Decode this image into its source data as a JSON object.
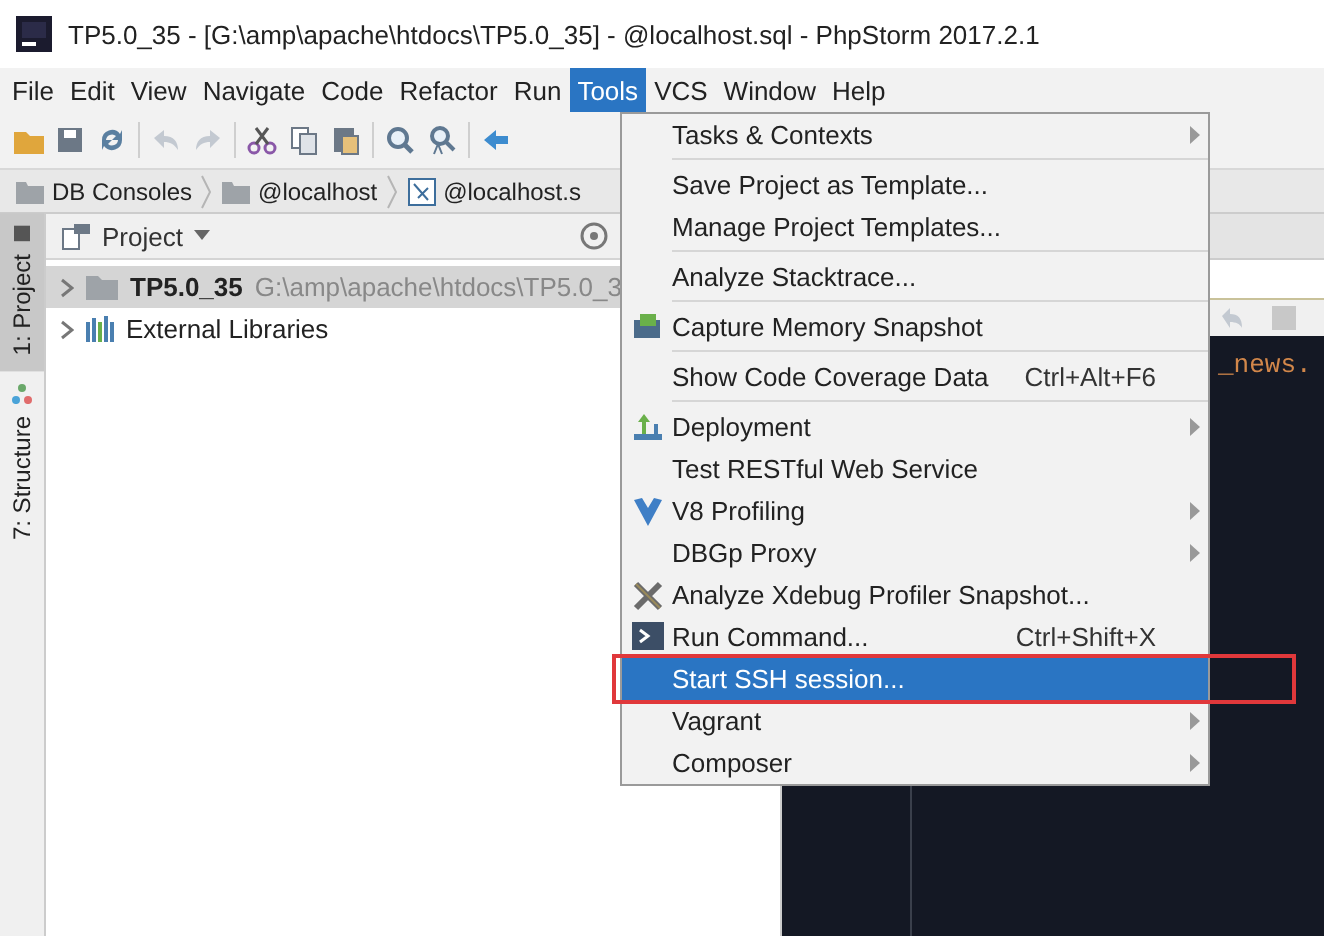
{
  "window": {
    "title": "TP5.0_35 - [G:\\amp\\apache\\htdocs\\TP5.0_35] - @localhost.sql - PhpStorm 2017.2.1"
  },
  "menu_bar": [
    {
      "label": "File",
      "selected": false
    },
    {
      "label": "Edit",
      "selected": false
    },
    {
      "label": "View",
      "selected": false
    },
    {
      "label": "Navigate",
      "selected": false
    },
    {
      "label": "Code",
      "selected": false
    },
    {
      "label": "Refactor",
      "selected": false
    },
    {
      "label": "Run",
      "selected": false
    },
    {
      "label": "Tools",
      "selected": true
    },
    {
      "label": "VCS",
      "selected": false
    },
    {
      "label": "Window",
      "selected": false
    },
    {
      "label": "Help",
      "selected": false
    }
  ],
  "breadcrumbs": [
    {
      "label": "DB Consoles",
      "kind": "folder"
    },
    {
      "label": "@localhost",
      "kind": "folder"
    },
    {
      "label": "@localhost.s",
      "kind": "file"
    }
  ],
  "tool_windows": [
    {
      "label": "1: Project",
      "selected": true
    },
    {
      "label": "7: Structure",
      "selected": false
    }
  ],
  "project_panel": {
    "title": "Project",
    "tree": [
      {
        "label": "TP5.0_35",
        "path": "G:\\amp\\apache\\htdocs\\TP5.0_3",
        "kind": "folder",
        "expanded": false,
        "selected": true
      },
      {
        "label": "External Libraries",
        "kind": "library",
        "expanded": false,
        "selected": false
      }
    ]
  },
  "editor": {
    "code_fragment": "_news."
  },
  "tools_menu": {
    "items": [
      {
        "kind": "item",
        "label": "Tasks & Contexts",
        "submenu": true,
        "selected": false
      },
      {
        "kind": "separator"
      },
      {
        "kind": "item",
        "label": "Save Project as Template...",
        "submenu": false,
        "selected": false
      },
      {
        "kind": "item",
        "label": "Manage Project Templates...",
        "submenu": false,
        "selected": false
      },
      {
        "kind": "separator"
      },
      {
        "kind": "item",
        "label": "Analyze Stacktrace...",
        "submenu": false,
        "selected": false
      },
      {
        "kind": "separator"
      },
      {
        "kind": "item",
        "label": "Capture Memory Snapshot",
        "submenu": false,
        "selected": false
      },
      {
        "kind": "separator"
      },
      {
        "kind": "item",
        "label": "Show Code Coverage Data",
        "shortcut": "Ctrl+Alt+F6",
        "submenu": false,
        "selected": false
      },
      {
        "kind": "separator"
      },
      {
        "kind": "item",
        "label": "Deployment",
        "submenu": true,
        "selected": false
      },
      {
        "kind": "item",
        "label": "Test RESTful Web Service",
        "submenu": false,
        "selected": false
      },
      {
        "kind": "item",
        "label": "V8 Profiling",
        "submenu": true,
        "selected": false
      },
      {
        "kind": "item",
        "label": "DBGp Proxy",
        "submenu": true,
        "selected": false
      },
      {
        "kind": "item",
        "label": "Analyze Xdebug Profiler Snapshot...",
        "submenu": false,
        "selected": false
      },
      {
        "kind": "item",
        "label": "Run Command...",
        "shortcut": "Ctrl+Shift+X",
        "submenu": false,
        "selected": false
      },
      {
        "kind": "item",
        "label": "Start SSH session...",
        "submenu": false,
        "selected": true,
        "outlined": true
      },
      {
        "kind": "item",
        "label": "Vagrant",
        "submenu": true,
        "selected": false
      },
      {
        "kind": "item",
        "label": "Composer",
        "submenu": true,
        "selected": false
      }
    ]
  }
}
